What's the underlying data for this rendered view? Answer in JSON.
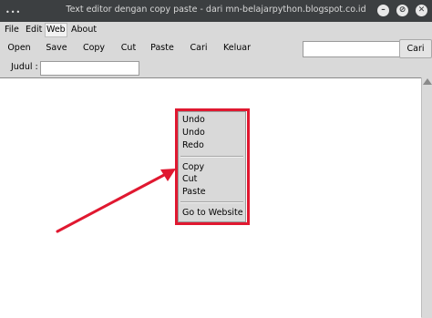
{
  "window": {
    "title": "Text editor dengan copy paste - dari mn-belajarpython.blogspot.co.id",
    "dots": "•••",
    "minimize_glyph": "–",
    "maximize_glyph": "⊘",
    "close_glyph": "✕"
  },
  "menubar": {
    "items": [
      {
        "label": "File"
      },
      {
        "label": "Edit"
      },
      {
        "label": "Web"
      },
      {
        "label": "About"
      }
    ]
  },
  "toolbar": {
    "buttons": [
      {
        "label": "Open"
      },
      {
        "label": "Save"
      },
      {
        "label": "Copy"
      },
      {
        "label": "Cut"
      },
      {
        "label": "Paste"
      },
      {
        "label": "Cari"
      },
      {
        "label": "Keluar"
      }
    ],
    "search_value": "",
    "search_button": "Cari"
  },
  "judul": {
    "label": "Judul :",
    "value": ""
  },
  "context_menu": {
    "items": [
      {
        "label": "Undo"
      },
      {
        "label": "Undo"
      },
      {
        "label": "Redo"
      },
      {
        "label": "Copy"
      },
      {
        "label": "Cut"
      },
      {
        "label": "Paste"
      },
      {
        "label": "Go to Website"
      }
    ]
  },
  "annotation": {
    "color": "#e01830"
  }
}
